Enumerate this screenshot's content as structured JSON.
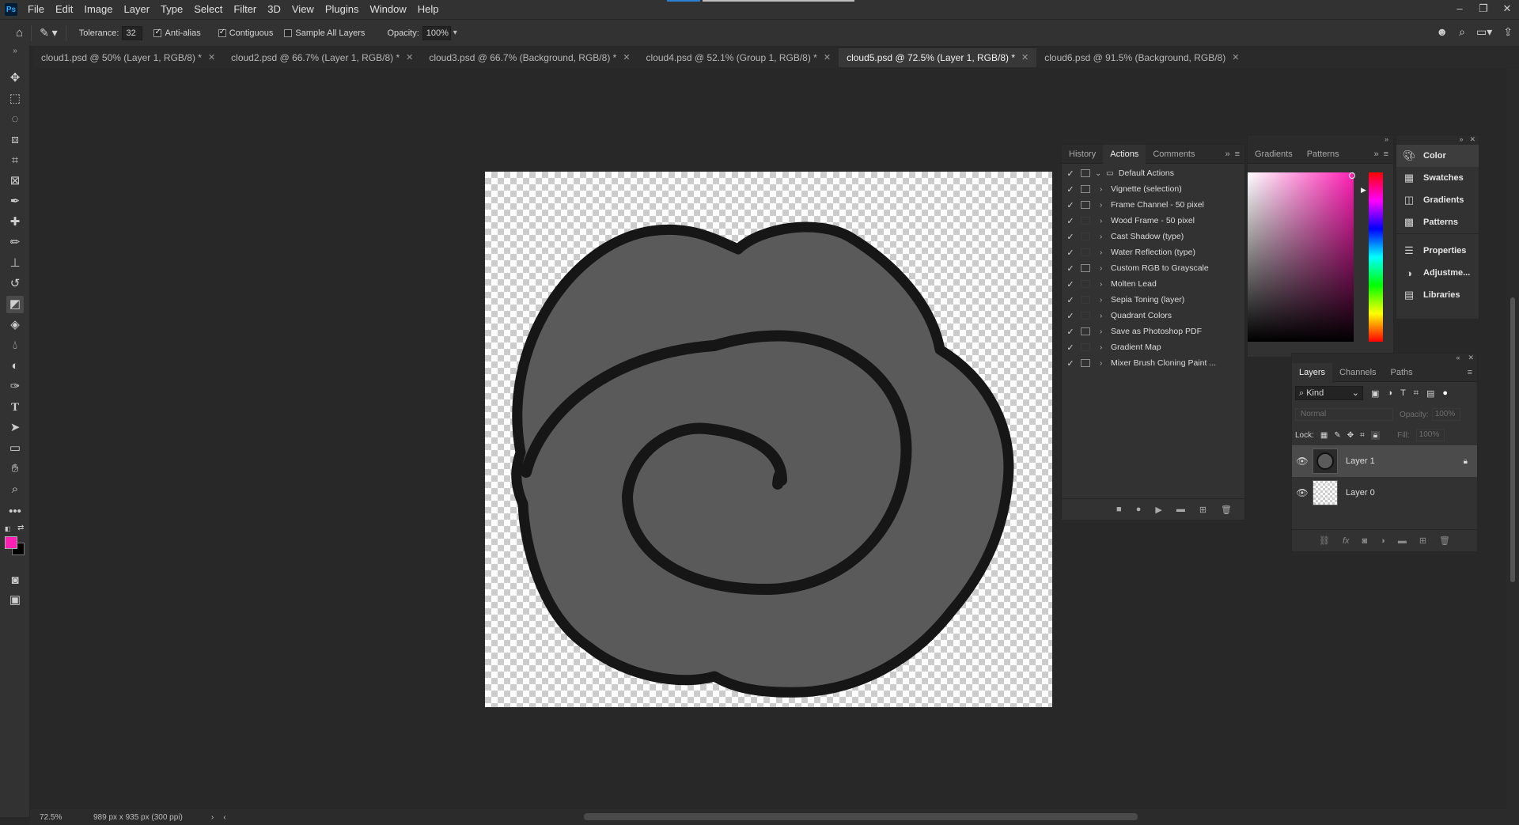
{
  "menu": [
    "File",
    "Edit",
    "Image",
    "Layer",
    "Type",
    "Select",
    "Filter",
    "3D",
    "View",
    "Plugins",
    "Window",
    "Help"
  ],
  "logo": "Ps",
  "options": {
    "tolerance_label": "Tolerance:",
    "tolerance_value": "32",
    "anti_alias": "Anti-alias",
    "contiguous": "Contiguous",
    "sample_all": "Sample All Layers",
    "opacity_label": "Opacity:",
    "opacity_value": "100%"
  },
  "tabs": [
    {
      "label": "cloud1.psd @ 50% (Layer 1, RGB/8) *"
    },
    {
      "label": "cloud2.psd @ 66.7% (Layer 1, RGB/8) *"
    },
    {
      "label": "cloud3.psd @ 66.7% (Background, RGB/8) *"
    },
    {
      "label": "cloud4.psd @ 52.1% (Group 1, RGB/8) *"
    },
    {
      "label": "cloud5.psd @ 72.5% (Layer 1, RGB/8) *",
      "active": true
    },
    {
      "label": "cloud6.psd @ 91.5% (Background, RGB/8)"
    }
  ],
  "actions_panel": {
    "tabs": [
      "History",
      "Actions",
      "Comments"
    ],
    "set_name": "Default Actions",
    "items": [
      {
        "label": "Vignette (selection)",
        "dialog": true
      },
      {
        "label": "Frame Channel - 50 pixel",
        "dialog": true
      },
      {
        "label": "Wood Frame - 50 pixel",
        "dialog": false
      },
      {
        "label": "Cast Shadow (type)",
        "dialog": false
      },
      {
        "label": "Water Reflection (type)",
        "dialog": false
      },
      {
        "label": "Custom RGB to Grayscale",
        "dialog": true
      },
      {
        "label": "Molten Lead",
        "dialog": false
      },
      {
        "label": "Sepia Toning (layer)",
        "dialog": false
      },
      {
        "label": "Quadrant Colors",
        "dialog": false
      },
      {
        "label": "Save as Photoshop PDF",
        "dialog": true
      },
      {
        "label": "Gradient Map",
        "dialog": false
      },
      {
        "label": "Mixer Brush Cloning Paint ...",
        "dialog": true
      }
    ]
  },
  "color_panel": {
    "tabs": [
      "Gradients",
      "Patterns"
    ]
  },
  "side_panel": {
    "items": [
      "Color",
      "Swatches",
      "Gradients",
      "Patterns",
      "Properties",
      "Adjustme...",
      "Libraries"
    ]
  },
  "layers_panel": {
    "tabs": [
      "Layers",
      "Channels",
      "Paths"
    ],
    "filter": "Kind",
    "blend_mode": "Normal",
    "opacity_label": "Opacity:",
    "opacity_value": "100%",
    "lock_label": "Lock:",
    "fill_label": "Fill:",
    "fill_value": "100%",
    "layers": [
      {
        "name": "Layer 1",
        "locked": true,
        "selected": true
      },
      {
        "name": "Layer 0",
        "locked": false,
        "selected": false
      }
    ]
  },
  "status": {
    "zoom": "72.5%",
    "doc_info": "989 px x 935 px (300 ppi)"
  },
  "colors": {
    "foreground": "#ff1fb4",
    "background": "#000000",
    "cloud_fill": "#5a5a5a",
    "cloud_stroke": "#161616"
  }
}
